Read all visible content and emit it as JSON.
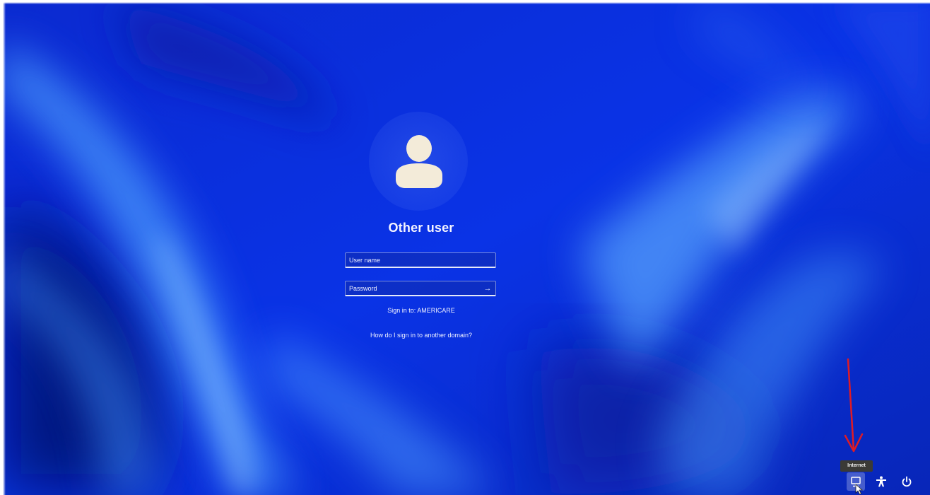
{
  "login": {
    "user_display_name": "Other user",
    "username_placeholder": "User name",
    "password_placeholder": "Password",
    "sign_in_to": "Sign in to: AMERICARE",
    "domain_help_link": "How do I sign in to another domain?"
  },
  "tray": {
    "network_tooltip": "Internet",
    "icons": [
      "network-icon",
      "accessibility-icon",
      "power-icon"
    ]
  },
  "colors": {
    "background": "#0a2fd8",
    "annotation_arrow": "#e01b24",
    "text": "#eef0ff"
  }
}
